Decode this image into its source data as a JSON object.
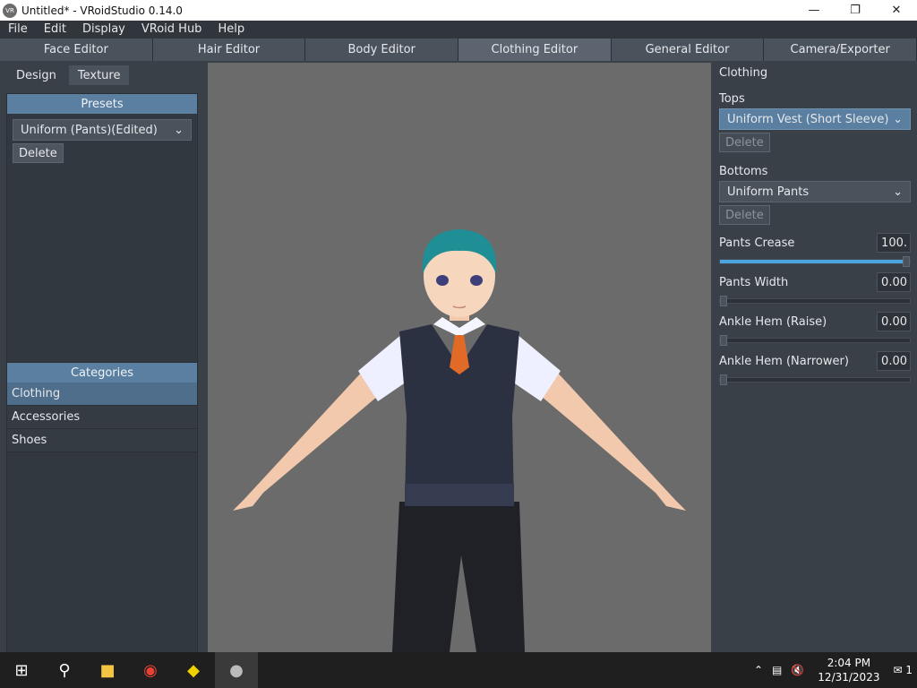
{
  "window": {
    "title": "Untitled* - VRoidStudio 0.14.0",
    "app_icon": "vroid-logo-icon",
    "controls": [
      "minimize-icon",
      "maximize-icon",
      "close-icon"
    ]
  },
  "menu": {
    "items": [
      "File",
      "Edit",
      "Display",
      "VRoid Hub",
      "Help"
    ]
  },
  "editor_tabs": [
    {
      "label": "Face Editor",
      "active": false
    },
    {
      "label": "Hair Editor",
      "active": false
    },
    {
      "label": "Body Editor",
      "active": false
    },
    {
      "label": "Clothing Editor",
      "active": true
    },
    {
      "label": "General Editor",
      "active": false
    },
    {
      "label": "Camera/Exporter",
      "active": false
    }
  ],
  "left_panel": {
    "subtabs": [
      {
        "label": "Design",
        "active": true
      },
      {
        "label": "Texture",
        "active": false
      }
    ],
    "presets": {
      "header": "Presets",
      "selected": "Uniform (Pants)(Edited)",
      "delete_label": "Delete"
    },
    "categories": {
      "header": "Categories",
      "items": [
        {
          "label": "Clothing",
          "active": true
        },
        {
          "label": "Accessories",
          "active": false
        },
        {
          "label": "Shoes",
          "active": false
        }
      ]
    }
  },
  "right_panel": {
    "title": "Clothing",
    "tops": {
      "label": "Tops",
      "selected": "Uniform Vest (Short Sleeve)",
      "delete_label": "Delete"
    },
    "bottoms": {
      "label": "Bottoms",
      "selected": "Uniform Pants",
      "delete_label": "Delete"
    },
    "sliders": [
      {
        "label": "Pants Crease",
        "value_text": "100.",
        "value": 1.0
      },
      {
        "label": "Pants Width",
        "value_text": "0.00",
        "value": 0.0
      },
      {
        "label": "Ankle Hem (Raise)",
        "value_text": "0.00",
        "value": 0.0
      },
      {
        "label": "Ankle Hem (Narrower)",
        "value_text": "0.00",
        "value": 0.0
      }
    ]
  },
  "colors": {
    "accent": "#5a7fa0",
    "slider_fill": "#4aa6e0",
    "viewport_bg": "#6b6b6b"
  },
  "taskbar": {
    "icons": [
      "windows-start-icon",
      "search-icon",
      "file-explorer-icon",
      "chrome-icon",
      "vroid-hub-icon",
      "vroid-studio-icon"
    ],
    "tray": {
      "time": "2:04 PM",
      "date": "12/31/2023",
      "notification_count": "1"
    }
  }
}
